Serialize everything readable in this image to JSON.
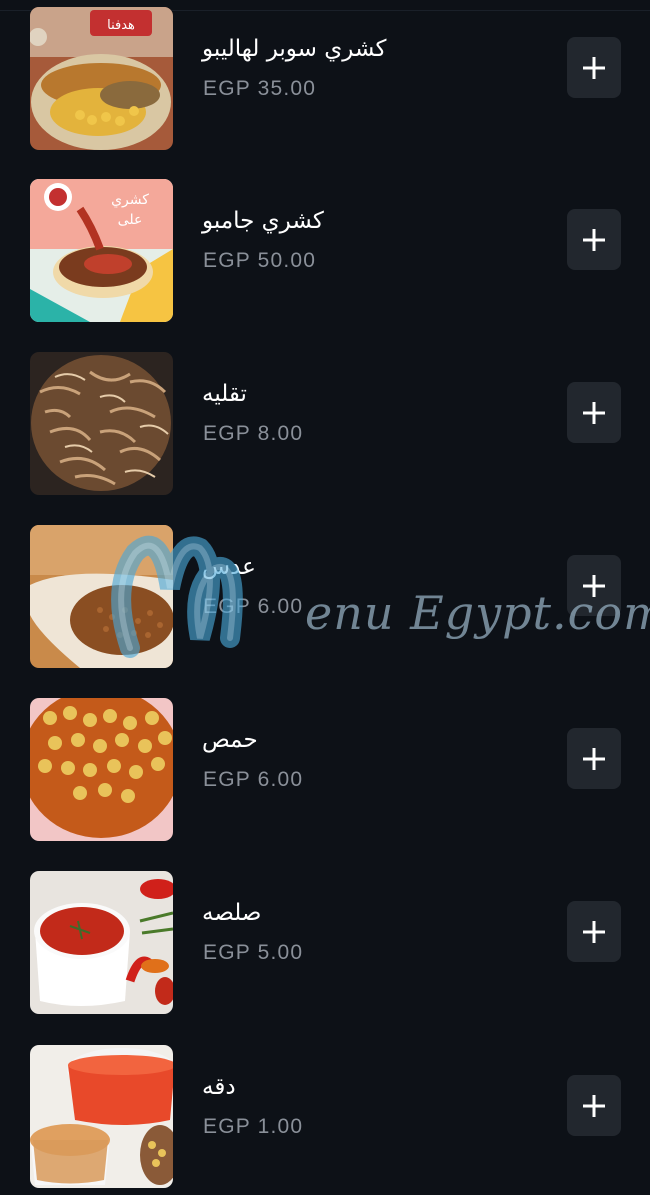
{
  "menu": {
    "items": [
      {
        "name": "كشري سوبر لهاليبو",
        "price": "EGP 35.00",
        "image_icon": "koshary-super-icon",
        "add_label": "+"
      },
      {
        "name": "كشري جامبو",
        "price": "EGP 50.00",
        "image_icon": "koshary-jumbo-icon",
        "add_label": "+"
      },
      {
        "name": "تقليه",
        "price": "EGP 8.00",
        "image_icon": "fried-onions-icon",
        "add_label": "+"
      },
      {
        "name": "عدس",
        "price": "EGP 6.00",
        "image_icon": "lentils-icon",
        "add_label": "+"
      },
      {
        "name": "حمص",
        "price": "EGP 6.00",
        "image_icon": "chickpeas-icon",
        "add_label": "+"
      },
      {
        "name": "صلصه",
        "price": "EGP 5.00",
        "image_icon": "tomato-sauce-icon",
        "add_label": "+"
      },
      {
        "name": "دقه",
        "price": "EGP 1.00",
        "image_icon": "garlic-vinegar-icon",
        "add_label": "+"
      }
    ]
  },
  "watermark": {
    "text": "enu Egypt.com"
  },
  "colors": {
    "background": "#0d1117",
    "button": "#22272e",
    "price_text": "#8a9099",
    "name_text": "#ffffff"
  }
}
